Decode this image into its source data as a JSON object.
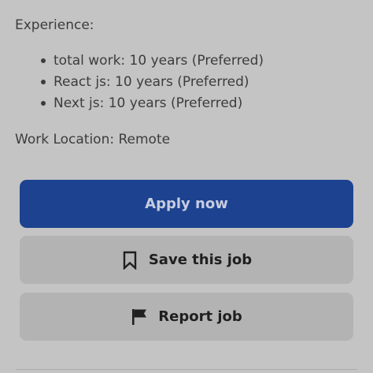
{
  "experience": {
    "heading": "Experience:",
    "items": [
      "total work: 10 years (Preferred)",
      "React js: 10 years (Preferred)",
      "Next js: 10 years (Preferred)"
    ]
  },
  "work_location": "Work Location: Remote",
  "actions": {
    "apply_label": "Apply now",
    "save_label": "Save this job",
    "save_icon": "bookmark-icon",
    "report_label": "Report job",
    "report_icon": "flag-icon"
  },
  "colors": {
    "background": "#c4c4c4",
    "apply_button": "#1d4290",
    "secondary_button": "#b3b3b3",
    "text": "#3c3c3c"
  }
}
